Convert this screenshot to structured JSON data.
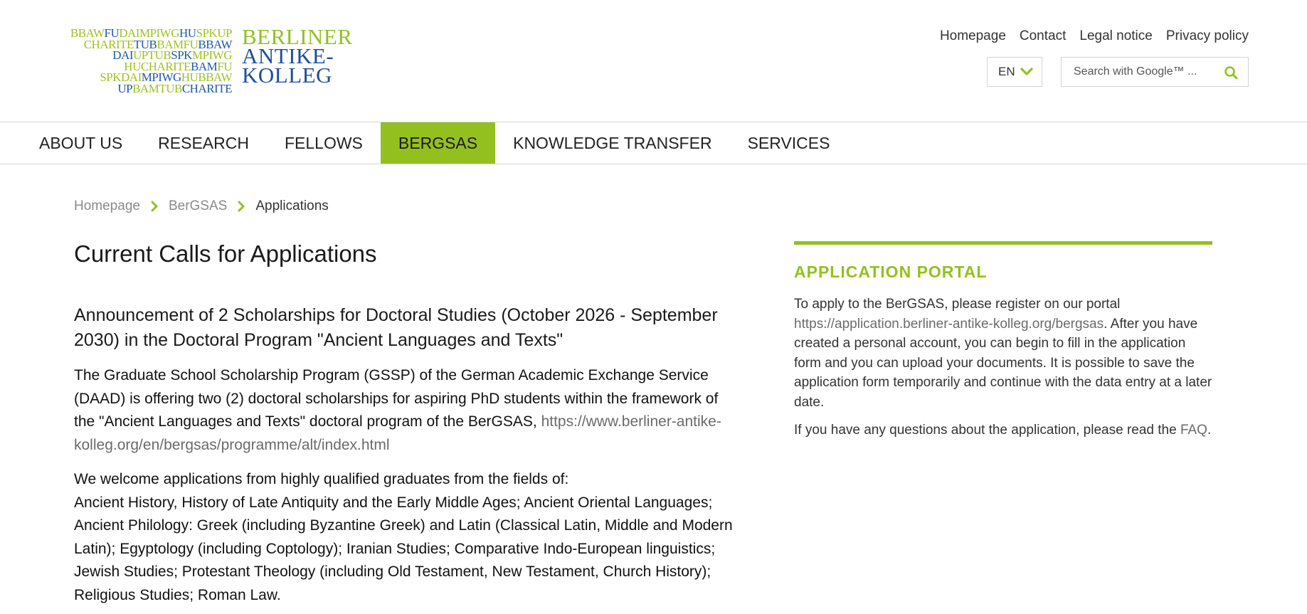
{
  "logo": {
    "mosaic": [
      {
        "parts": [
          {
            "t": "BBAW",
            "c": "#9cc31e"
          },
          {
            "t": "FU",
            "c": "#1c5aa8"
          },
          {
            "t": "DAI",
            "c": "#9cc31e"
          },
          {
            "t": "MPIWG",
            "c": "#9cc31e"
          },
          {
            "t": "HU",
            "c": "#1c5aa8"
          },
          {
            "t": "SPK",
            "c": "#9cc31e"
          },
          {
            "t": "UP",
            "c": "#9cc31e"
          }
        ]
      },
      {
        "parts": [
          {
            "t": "CHARITE",
            "c": "#9cc31e"
          },
          {
            "t": "TUB",
            "c": "#1c5aa8"
          },
          {
            "t": "BAM",
            "c": "#9cc31e"
          },
          {
            "t": "FU",
            "c": "#9cc31e"
          },
          {
            "t": "BBAW",
            "c": "#1c5aa8"
          }
        ]
      },
      {
        "parts": [
          {
            "t": "DAI",
            "c": "#1c5aa8"
          },
          {
            "t": "UP",
            "c": "#9cc31e"
          },
          {
            "t": "TUB",
            "c": "#9cc31e"
          },
          {
            "t": "SPK",
            "c": "#1c5aa8"
          },
          {
            "t": "MPIWG",
            "c": "#9cc31e"
          }
        ]
      },
      {
        "parts": [
          {
            "t": "HU",
            "c": "#9cc31e"
          },
          {
            "t": "CHARITE",
            "c": "#9cc31e"
          },
          {
            "t": "BAM",
            "c": "#1c5aa8"
          },
          {
            "t": "FU",
            "c": "#9cc31e"
          }
        ]
      },
      {
        "parts": [
          {
            "t": "SPK",
            "c": "#9cc31e"
          },
          {
            "t": "DAI",
            "c": "#9cc31e"
          },
          {
            "t": "MPIWG",
            "c": "#1c5aa8"
          },
          {
            "t": "HU",
            "c": "#9cc31e"
          },
          {
            "t": "BBAW",
            "c": "#9cc31e"
          }
        ]
      },
      {
        "parts": [
          {
            "t": "UP",
            "c": "#1c5aa8"
          },
          {
            "t": "BAM",
            "c": "#9cc31e"
          },
          {
            "t": "TUB",
            "c": "#9cc31e"
          },
          {
            "t": "CHARITE",
            "c": "#1c5aa8"
          }
        ]
      }
    ],
    "text_lines": [
      {
        "t": "BERLINER",
        "c": "#93c01f"
      },
      {
        "t": "ANTIKE-",
        "c": "#1c4f9c"
      },
      {
        "t": "KOLLEG",
        "c": "#1c4f9c"
      }
    ]
  },
  "top_links": [
    "Homepage",
    "Contact",
    "Legal notice",
    "Privacy policy"
  ],
  "language": {
    "selected": "EN"
  },
  "search": {
    "placeholder": "Search with Google™ ..."
  },
  "nav": {
    "items": [
      "ABOUT US",
      "RESEARCH",
      "FELLOWS",
      "BERGSAS",
      "KNOWLEDGE TRANSFER",
      "SERVICES"
    ],
    "active": "BERGSAS"
  },
  "breadcrumb": {
    "items": [
      "Homepage",
      "BerGSAS"
    ],
    "current": "Applications"
  },
  "main": {
    "title": "Current Calls for Applications",
    "call_title": "Announcement of 2 Scholarships for Doctoral Studies (October 2026 - September 2030) in the Doctoral Program \"Ancient Languages and Texts\"",
    "para1_text": " The Graduate School Scholarship Program (GSSP) of the German Academic Exchange Service (DAAD) is offering two (2) doctoral scholarships for aspiring PhD students within the framework of the \"Ancient Languages and Texts\" doctoral program of the BerGSAS, ",
    "para1_link": "https://www.berliner-antike-kolleg.org/en/bergsas/programme/alt/index.html",
    "para2_intro": " We welcome applications from highly qualified graduates from the fields of:",
    "para2_fields": "Ancient History, History of Late Antiquity and the Early Middle Ages; Ancient Oriental Languages; Ancient Philology: Greek (including Byzantine Greek) and Latin (Classical Latin, Middle and Modern Latin); Egyptology (including Coptology); Iranian Studies; Comparative Indo-European linguistics; Jewish Studies; Protestant Theology (including Old Testament, New Testament, Church History); Religious Studies; Roman Law."
  },
  "sidebar": {
    "title": "APPLICATION PORTAL",
    "p1_before": "To apply to the BerGSAS, please register on our portal ",
    "p1_link": "https://application.berliner-antike-kolleg.org/bergsas",
    "p1_after": ". After you have created a personal account, you can begin to fill in the application form and you can upload your documents. It is possible to save the ap­plication form temporarily and continue with the data entry at a later date.",
    "p2_before": "If you have any questions about the application, please read the ",
    "p2_link": "FAQ",
    "p2_after": "."
  },
  "colors": {
    "accent": "#93c01f",
    "logo_blue": "#1c4f9c"
  }
}
